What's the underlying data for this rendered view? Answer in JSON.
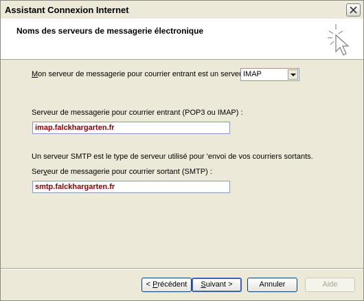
{
  "window": {
    "title": "Assistant Connexion Internet"
  },
  "header": {
    "title": "Noms des serveurs de messagerie électronique"
  },
  "form": {
    "server_type": {
      "label_pre": "M",
      "label_rest": "on serveur de messagerie pour courrier entrant est un serveur",
      "selected": "IMAP"
    },
    "incoming": {
      "label": "Serveur de messagerie pour courrier entrant (POP3 ou IMAP) :",
      "value": "imap.falckhargarten.fr"
    },
    "smtp_note": "Un serveur SMTP est le type de serveur utilisé pour 'envoi de vos courriers sortants.",
    "outgoing": {
      "label_pre": "Ser",
      "label_u": "v",
      "label_rest": "eur de messagerie pour courrier sortant (SMTP) :",
      "value": "smtp.falckhargarten.fr"
    }
  },
  "buttons": {
    "back_pre": "< ",
    "back_u": "P",
    "back_rest": "récédent",
    "next_u": "S",
    "next_rest": "uivant >",
    "cancel": "Annuler",
    "help": "Aide"
  }
}
